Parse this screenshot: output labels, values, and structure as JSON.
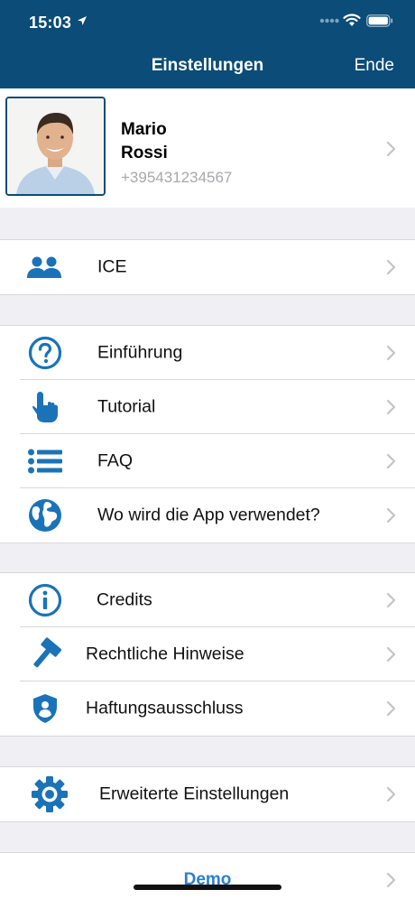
{
  "status_bar": {
    "time": "15:03"
  },
  "nav": {
    "title": "Einstellungen",
    "done_label": "Ende"
  },
  "profile": {
    "first_name": "Mario",
    "last_name": "Rossi",
    "phone": "+395431234567"
  },
  "groups": {
    "ice": {
      "label": "ICE"
    },
    "intro": {
      "label": "Einführung"
    },
    "tutorial": {
      "label": "Tutorial"
    },
    "faq": {
      "label": "FAQ"
    },
    "where": {
      "label": "Wo wird die App verwendet?"
    },
    "credits": {
      "label": "Credits"
    },
    "legal": {
      "label": "Rechtliche Hinweise"
    },
    "disclaimer": {
      "label": "Haftungsausschluss"
    },
    "advanced": {
      "label": "Erweiterte Einstellungen"
    }
  },
  "demo": {
    "label": "Demo"
  },
  "colors": {
    "brand": "#0b4c78",
    "icon": "#1a73b8",
    "link": "#2b7fd3"
  }
}
